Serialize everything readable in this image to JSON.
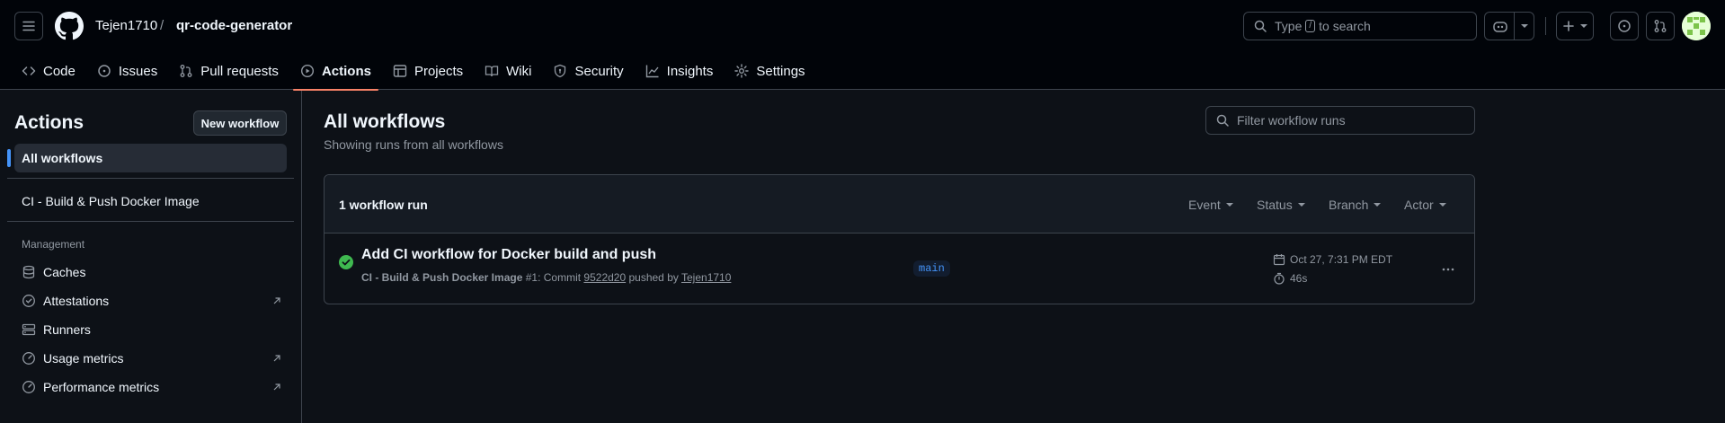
{
  "header": {
    "owner": "Tejen1710",
    "separator": "/",
    "repo": "qr-code-generator",
    "search_prefix": "Type",
    "search_key": "/",
    "search_suffix": "to search"
  },
  "tabs": [
    {
      "label": "Code",
      "icon": "code-icon"
    },
    {
      "label": "Issues",
      "icon": "issue-icon"
    },
    {
      "label": "Pull requests",
      "icon": "pull-request-icon"
    },
    {
      "label": "Actions",
      "icon": "play-icon",
      "active": true
    },
    {
      "label": "Projects",
      "icon": "table-icon"
    },
    {
      "label": "Wiki",
      "icon": "book-icon"
    },
    {
      "label": "Security",
      "icon": "shield-icon"
    },
    {
      "label": "Insights",
      "icon": "graph-icon"
    },
    {
      "label": "Settings",
      "icon": "gear-icon"
    }
  ],
  "sidebar": {
    "title": "Actions",
    "new_workflow": "New workflow",
    "all_workflows": "All workflows",
    "workflow": "CI - Build & Push Docker Image",
    "management_heading": "Management",
    "items": [
      {
        "label": "Caches",
        "icon": "database-icon",
        "external": false
      },
      {
        "label": "Attestations",
        "icon": "verified-icon",
        "external": true
      },
      {
        "label": "Runners",
        "icon": "server-icon",
        "external": false
      },
      {
        "label": "Usage metrics",
        "icon": "meter-icon",
        "external": true
      },
      {
        "label": "Performance metrics",
        "icon": "meter-icon",
        "external": true
      }
    ]
  },
  "main": {
    "title": "All workflows",
    "subtitle": "Showing runs from all workflows",
    "filter_placeholder": "Filter workflow runs",
    "run_count": "1 workflow run",
    "filters": [
      "Event",
      "Status",
      "Branch",
      "Actor"
    ],
    "run": {
      "title": "Add CI workflow for Docker build and push",
      "workflow_name": "CI - Build & Push Docker Image",
      "run_number": "#1",
      "commit_prefix": ": Commit",
      "commit": "9522d20",
      "pushed_by": "pushed by",
      "actor": "Tejen1710",
      "branch": "main",
      "date": "Oct 27, 7:31 PM EDT",
      "duration": "46s",
      "status": "success"
    }
  },
  "colors": {
    "accent_tab": "#f78166",
    "success": "#3fb950",
    "link": "#4493f8",
    "background": "#0d1117",
    "header_bg": "#010409"
  }
}
